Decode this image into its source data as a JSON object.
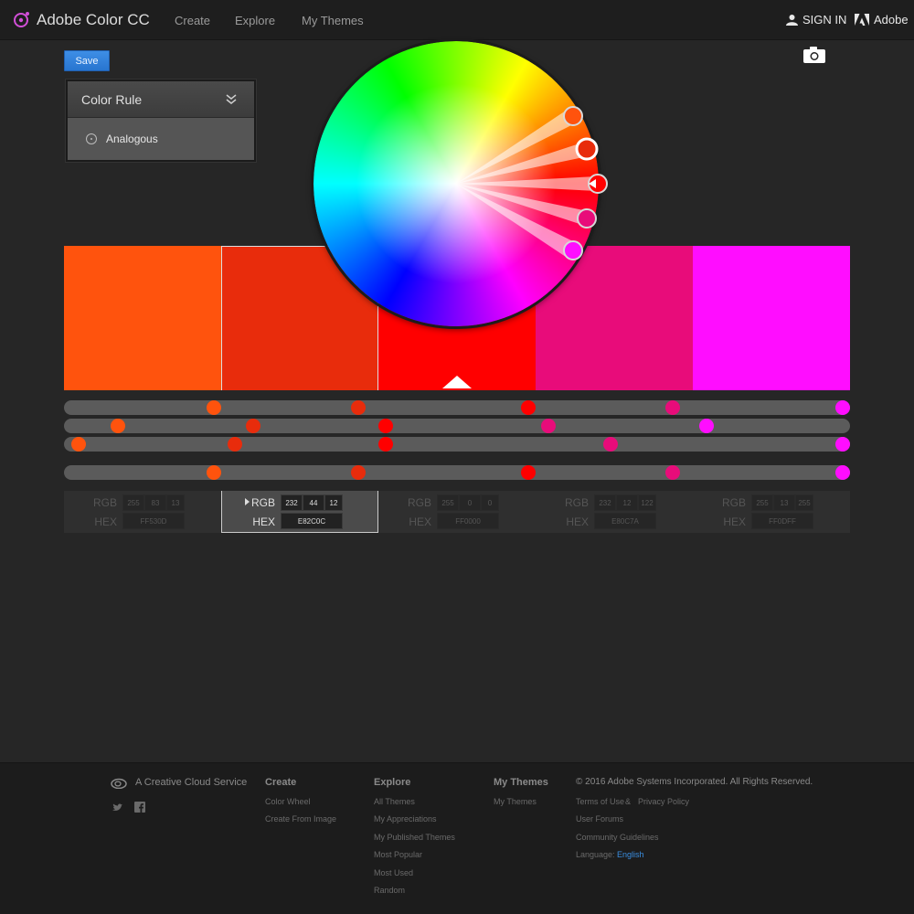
{
  "header": {
    "app_name": "Adobe Color CC",
    "nav": [
      {
        "label": "Create"
      },
      {
        "label": "Explore"
      },
      {
        "label": "My Themes"
      }
    ],
    "sign_in": "SIGN IN",
    "adobe": "Adobe"
  },
  "toolbar": {
    "save_label": "Save",
    "camera_icon": "camera-icon"
  },
  "color_rule": {
    "title": "Color Rule",
    "selected_option": "Analogous"
  },
  "swatches": [
    {
      "hex": "FF530D",
      "rgb": [
        "255",
        "83",
        "13"
      ]
    },
    {
      "hex": "E82C0C",
      "rgb": [
        "232",
        "44",
        "12"
      ]
    },
    {
      "hex": "FF0000",
      "rgb": [
        "255",
        "0",
        "0"
      ]
    },
    {
      "hex": "E80C7A",
      "rgb": [
        "232",
        "12",
        "122"
      ]
    },
    {
      "hex": "FF0DFF",
      "rgb": [
        "255",
        "13",
        "255"
      ]
    }
  ],
  "selected_swatch": 1,
  "value_labels": {
    "rgb": "RGB",
    "hex": "HEX"
  },
  "colors": {
    "accent": "#2d7fd9",
    "background": "#262626",
    "footer": "#1c1c1c"
  },
  "footer": {
    "creative_cloud": "A Creative Cloud Service",
    "create_heading": "Create",
    "create_links": [
      "Color Wheel",
      "Create From Image"
    ],
    "explore_heading": "Explore",
    "explore_links": [
      "All Themes",
      "My Appreciations",
      "My Published Themes",
      "Most Popular",
      "Most Used",
      "Random"
    ],
    "mythemes_heading": "My Themes",
    "mythemes_links": [
      "My Themes"
    ],
    "copyright": "© 2016 Adobe Systems Incorporated. All Rights Reserved.",
    "terms": "Terms of Use",
    "amp": "&",
    "privacy": "Privacy Policy",
    "user_forums": "User Forums",
    "guidelines": "Community Guidelines",
    "language_label": "Language:",
    "language_value": "English"
  }
}
